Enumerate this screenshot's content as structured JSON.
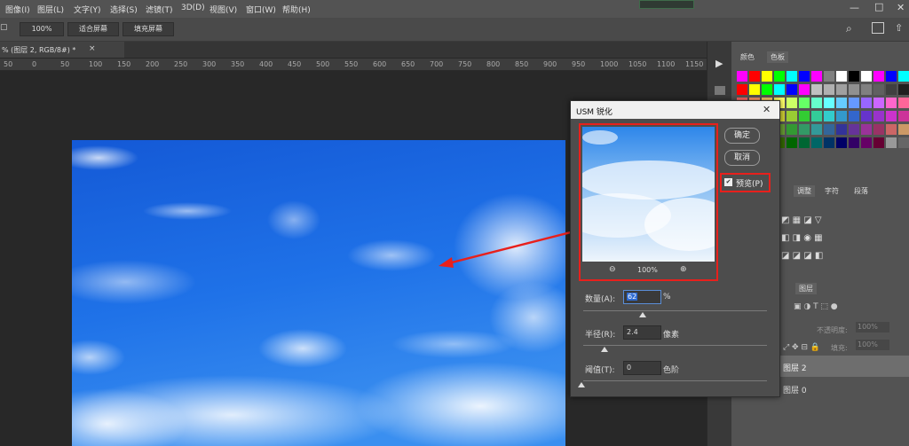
{
  "menubar": {
    "items": [
      "图像(I)",
      "图层(L)",
      "文字(Y)",
      "选择(S)",
      "滤镜(T)",
      "3D(D)",
      "视图(V)",
      "窗口(W)",
      "帮助(H)"
    ]
  },
  "options": {
    "zoom_value": "100%",
    "fit_screen": "适合屏幕",
    "fill_screen": "填充屏幕"
  },
  "document": {
    "tab_title": "% (图层 2, RGB/8#) *"
  },
  "ruler": {
    "ticks": [
      "50",
      "0",
      "50",
      "100",
      "150",
      "200",
      "250",
      "300",
      "350",
      "400",
      "450",
      "500",
      "550",
      "600",
      "650",
      "700",
      "750",
      "800",
      "850",
      "900",
      "950",
      "1000",
      "1050",
      "1100",
      "1150"
    ]
  },
  "panels": {
    "color_tab": "颜色",
    "swatches_tab": "色板",
    "adjust_tab": "调整",
    "char_tab": "字符",
    "para_tab": "段落",
    "layers_tab": "图层",
    "opacity_label": "不透明度:",
    "opacity_value": "100%",
    "fill_label": "填充:",
    "fill_value": "100%",
    "layers": [
      "图层 2",
      "图层 0"
    ]
  },
  "dialog": {
    "title": "USM 锐化",
    "ok": "确定",
    "cancel": "取消",
    "preview_label": "预览(P)",
    "preview_zoom": "100%",
    "amount_label": "数量(A):",
    "amount_value": "62",
    "amount_unit": "%",
    "radius_label": "半径(R):",
    "radius_value": "2.4",
    "radius_unit": "像素",
    "threshold_label": "阈值(T):",
    "threshold_value": "0",
    "threshold_unit": "色阶"
  },
  "colors": {
    "highlight_red": "#e8201c",
    "sky_deep": "#1a52c8",
    "sky_light": "#2f8ef0"
  }
}
